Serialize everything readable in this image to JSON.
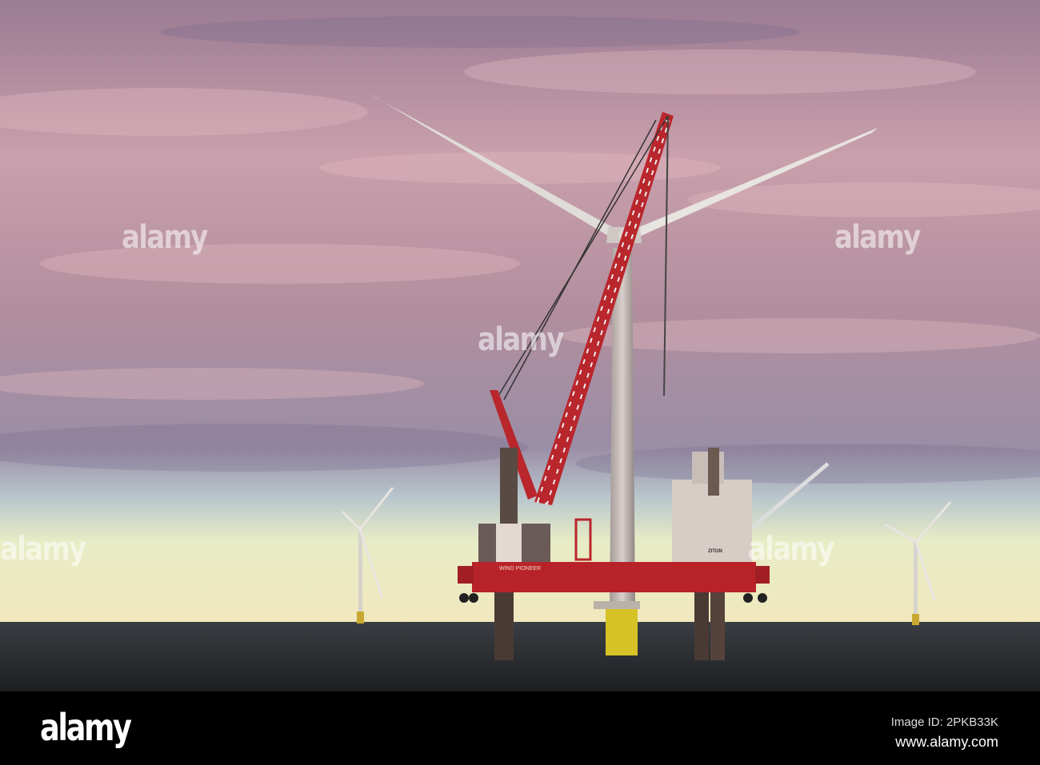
{
  "photo": {
    "subject": "Offshore wind turbine installation vessel",
    "vessel_name": "WIND PIONEER",
    "vessel_brand": "ZITON",
    "colors": {
      "sky_top": "#8a6e86",
      "sky_pink": "#c79aa6",
      "horizon": "#eef0c4",
      "sea": "#24282c",
      "hull": "#b8232a"
    }
  },
  "watermarks": {
    "text": "alamy"
  },
  "footer": {
    "logo": "alamy",
    "image_id": "Image ID: 2PKB33K",
    "url": "www.alamy.com"
  }
}
